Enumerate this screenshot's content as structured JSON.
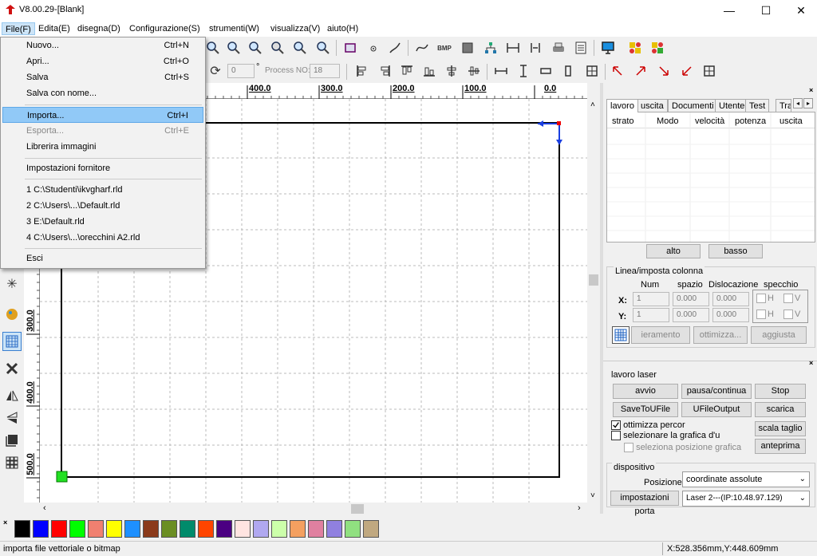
{
  "title": "V8.00.29-[Blank]",
  "window_controls": {
    "minimize": "—",
    "maximize": "☐",
    "close": "✕"
  },
  "menu": [
    "File(F)",
    "Edita(E)",
    "disegna(D)",
    "Configurazione(S)",
    "strumenti(W)",
    "visualizza(V)",
    "aiuto(H)"
  ],
  "file_menu": {
    "items": [
      {
        "label": "Nuovo...",
        "shortcut": "Ctrl+N"
      },
      {
        "label": "Apri...",
        "shortcut": "Ctrl+O"
      },
      {
        "label": "Salva",
        "shortcut": "Ctrl+S"
      },
      {
        "label": "Salva con nome...",
        "shortcut": ""
      },
      {
        "label": "Importa...",
        "shortcut": "Ctrl+I"
      },
      {
        "label": "Esporta...",
        "shortcut": "Ctrl+E"
      },
      {
        "label": "Librerira immagini",
        "shortcut": ""
      },
      {
        "label": "Impostazioni fornitore",
        "shortcut": ""
      },
      {
        "label": "1 C:\\Studenti\\ikvgharf.rld",
        "shortcut": ""
      },
      {
        "label": "2 C:\\Users\\...\\Default.rld",
        "shortcut": ""
      },
      {
        "label": "3 E:\\Default.rld",
        "shortcut": ""
      },
      {
        "label": "4 C:\\Users\\...\\orecchini A2.rld",
        "shortcut": ""
      },
      {
        "label": "Esci",
        "shortcut": ""
      }
    ]
  },
  "toolbar2": {
    "angle_value": "0",
    "degree": "°",
    "process_label": "Process NO:",
    "process_value": "18"
  },
  "ruler_top_labels": [
    "400.0",
    "300.0",
    "200.0",
    "100.0",
    "0.0"
  ],
  "ruler_left_labels": [
    "300.0",
    "400.0",
    "500.0"
  ],
  "right_panel": {
    "tabs": [
      "lavoro",
      "uscita",
      "Documenti",
      "Utente",
      "Test",
      "Tra"
    ],
    "table_headers": [
      "strato",
      "Modo",
      "velocità",
      "potenza",
      "uscita"
    ],
    "up_button": "alto",
    "down_button": "basso",
    "array_group": {
      "title": "Linea/imposta colonna",
      "headers": [
        "Num",
        "spazio",
        "Dislocazione",
        "specchio"
      ],
      "x_label": "X:",
      "y_label": "Y:",
      "x_num": "1",
      "x_space": "0.000",
      "x_disloc": "0.000",
      "y_num": "1",
      "y_space": "0.000",
      "y_disloc": "0.000",
      "h": "H",
      "v": "V",
      "virtual_btn": "ieramento virtu",
      "optimize_btn": "ottimizza...",
      "update_btn": "aggiusta"
    }
  },
  "laser_panel": {
    "title": "lavoro laser",
    "start": "avvio",
    "pause": "pausa/continua",
    "stop": "Stop",
    "save_file": "SaveToUFile",
    "ufile_output": "UFileOutput",
    "download": "scarica",
    "opt_path": "ottimizza percor",
    "opt_path_checked": true,
    "select_graphic": "selezionare la grafica d'u",
    "select_graphic_checked": false,
    "select_pos": "seleziona posizione grafica",
    "cut_scale": "scala taglio",
    "preview": "anteprima",
    "device_title": "dispositivo",
    "position_label": "Posizione:",
    "position_value": "coordinate assolute",
    "port_settings": "impostazioni porta",
    "laser_value": "Laser 2---(IP:10.48.97.129)"
  },
  "palette": [
    "#000000",
    "#0000ff",
    "#ff0000",
    "#00ff00",
    "#f08070",
    "#ffff00",
    "#1e90ff",
    "#8b3a1a",
    "#6b8e23",
    "#008b6b",
    "#ff4500",
    "#4b0082",
    "#ffe4e1",
    "#b0a8f0",
    "#ccffaa",
    "#f4a060",
    "#e080a0",
    "#9080e0",
    "#90e080",
    "#c0a880"
  ],
  "status": {
    "hint": "importa file vettoriale o bitmap",
    "coords": "X:528.356mm,Y:448.609mm"
  }
}
